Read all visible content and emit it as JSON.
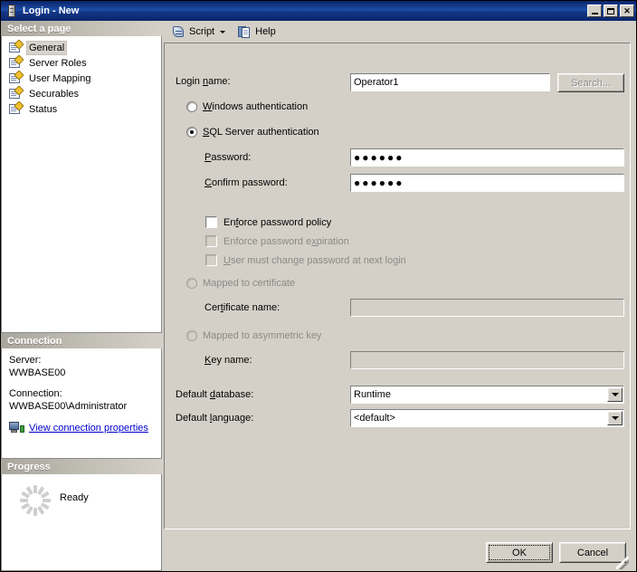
{
  "window": {
    "title": "Login - New",
    "icon": "server-icon",
    "controls": {
      "minimize": "Minimize",
      "maximize": "Maximize",
      "close": "Close"
    }
  },
  "sidebar": {
    "pages_header": "Select a page",
    "pages": [
      {
        "label": "General",
        "selected": true
      },
      {
        "label": "Server Roles",
        "selected": false
      },
      {
        "label": "User Mapping",
        "selected": false
      },
      {
        "label": "Securables",
        "selected": false
      },
      {
        "label": "Status",
        "selected": false
      }
    ],
    "connection_header": "Connection",
    "connection": {
      "server_label": "Server:",
      "server_value": "WWBASE00",
      "connection_label": "Connection:",
      "connection_value": "WWBASE00\\Administrator",
      "link": "View connection properties"
    },
    "progress_header": "Progress",
    "progress": {
      "status": "Ready"
    }
  },
  "toolbar": {
    "script_label": "Script",
    "help_label": "Help"
  },
  "form": {
    "login_name_label": "Login name:",
    "login_name_value": "Operator1",
    "search_button": "Search...",
    "windows_auth_label": "Windows authentication",
    "sql_auth_label": "SQL Server authentication",
    "password_label": "Password:",
    "password_value": "●●●●●●",
    "confirm_password_label": "Confirm password:",
    "confirm_password_value": "●●●●●●",
    "enforce_policy_label": "Enforce password policy",
    "enforce_expiration_label": "Enforce password expiration",
    "must_change_label": "User must change password at next login",
    "mapped_certificate_label": "Mapped to certificate",
    "certificate_name_label": "Certificate name:",
    "certificate_name_value": "",
    "mapped_asymmetric_label": "Mapped to asymmetric key",
    "key_name_label": "Key name:",
    "key_name_value": "",
    "default_database_label": "Default database:",
    "default_database_value": "Runtime",
    "default_language_label": "Default language:",
    "default_language_value": "<default>"
  },
  "footer": {
    "ok_label": "OK",
    "cancel_label": "Cancel"
  },
  "colors": {
    "titlebar": "#0a246a",
    "dialog_face": "#d4d0c8",
    "link": "#0000cc",
    "disabled_text": "#8a8a86"
  }
}
